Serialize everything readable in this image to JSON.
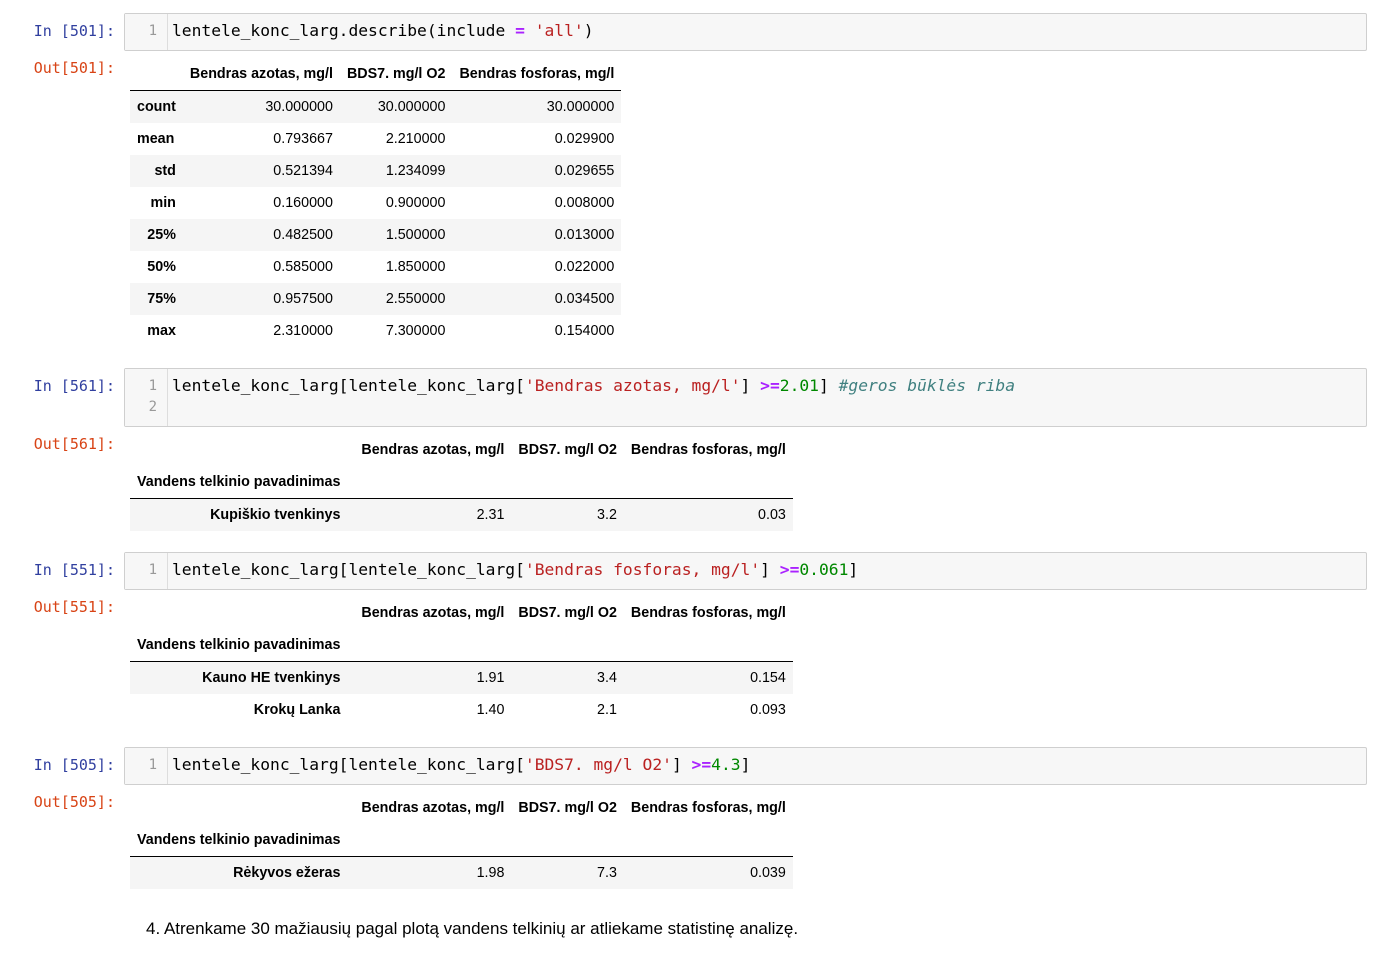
{
  "cells": [
    {
      "in_prompt": "In [501]:",
      "out_prompt": "Out[501]:",
      "line_numbers": [
        "1"
      ],
      "code": {
        "prefix": "lentele_konc_larg.describe(include ",
        "op": "=",
        "space": " ",
        "str": "'all'",
        "suffix": ")"
      },
      "table": {
        "columns": [
          "Bendras azotas, mg/l",
          "BDS7. mg/l O2",
          "Bendras fosforas, mg/l"
        ],
        "rows": [
          {
            "index": "count",
            "values": [
              "30.000000",
              "30.000000",
              "30.000000"
            ]
          },
          {
            "index": "mean",
            "values": [
              "0.793667",
              "2.210000",
              "0.029900"
            ]
          },
          {
            "index": "std",
            "values": [
              "0.521394",
              "1.234099",
              "0.029655"
            ]
          },
          {
            "index": "min",
            "values": [
              "0.160000",
              "0.900000",
              "0.008000"
            ]
          },
          {
            "index": "25%",
            "values": [
              "0.482500",
              "1.500000",
              "0.013000"
            ]
          },
          {
            "index": "50%",
            "values": [
              "0.585000",
              "1.850000",
              "0.022000"
            ]
          },
          {
            "index": "75%",
            "values": [
              "0.957500",
              "2.550000",
              "0.034500"
            ]
          },
          {
            "index": "max",
            "values": [
              "2.310000",
              "7.300000",
              "0.154000"
            ]
          }
        ]
      }
    },
    {
      "in_prompt": "In [561]:",
      "out_prompt": "Out[561]:",
      "line_numbers": [
        "1",
        "2"
      ],
      "code": {
        "prefix": "lentele_konc_larg[lentele_konc_larg[",
        "str": "'Bendras azotas, mg/l'",
        "mid": "] ",
        "op": ">=",
        "num": "2.01",
        "close": "] ",
        "comment": "#geros būklės riba"
      },
      "table": {
        "columns": [
          "Bendras azotas, mg/l",
          "BDS7. mg/l O2",
          "Bendras fosforas, mg/l"
        ],
        "index_name": "Vandens telkinio pavadinimas",
        "rows": [
          {
            "index": "Kupiškio tvenkinys",
            "values": [
              "2.31",
              "3.2",
              "0.03"
            ]
          }
        ]
      }
    },
    {
      "in_prompt": "In [551]:",
      "out_prompt": "Out[551]:",
      "line_numbers": [
        "1"
      ],
      "code": {
        "prefix": "lentele_konc_larg[lentele_konc_larg[",
        "str": "'Bendras fosforas, mg/l'",
        "mid": "] ",
        "op": ">=",
        "num": "0.061",
        "close": "]"
      },
      "table": {
        "columns": [
          "Bendras azotas, mg/l",
          "BDS7. mg/l O2",
          "Bendras fosforas, mg/l"
        ],
        "index_name": "Vandens telkinio pavadinimas",
        "rows": [
          {
            "index": "Kauno HE tvenkinys",
            "values": [
              "1.91",
              "3.4",
              "0.154"
            ]
          },
          {
            "index": "Krokų Lanka",
            "values": [
              "1.40",
              "2.1",
              "0.093"
            ]
          }
        ]
      }
    },
    {
      "in_prompt": "In [505]:",
      "out_prompt": "Out[505]:",
      "line_numbers": [
        "1"
      ],
      "code": {
        "prefix": "lentele_konc_larg[lentele_konc_larg[",
        "str": "'BDS7. mg/l O2'",
        "mid": "] ",
        "op": ">=",
        "num": "4.3",
        "close": "]"
      },
      "table": {
        "columns": [
          "Bendras azotas, mg/l",
          "BDS7. mg/l O2",
          "Bendras fosforas, mg/l"
        ],
        "index_name": "Vandens telkinio pavadinimas",
        "rows": [
          {
            "index": "Rėkyvos ežeras",
            "values": [
              "1.98",
              "7.3",
              "0.039"
            ]
          }
        ]
      }
    }
  ],
  "markdown": {
    "text": "4. Atrenkame 30 mažiausių pagal plotą vandens telkinių ar atliekame statistinę analizę."
  },
  "colors": {
    "in_prompt": "#303f9f",
    "out_prompt": "#d84315",
    "string": "#ba2121",
    "operator": "#aa22ff",
    "number": "#008800",
    "comment": "#408080"
  }
}
